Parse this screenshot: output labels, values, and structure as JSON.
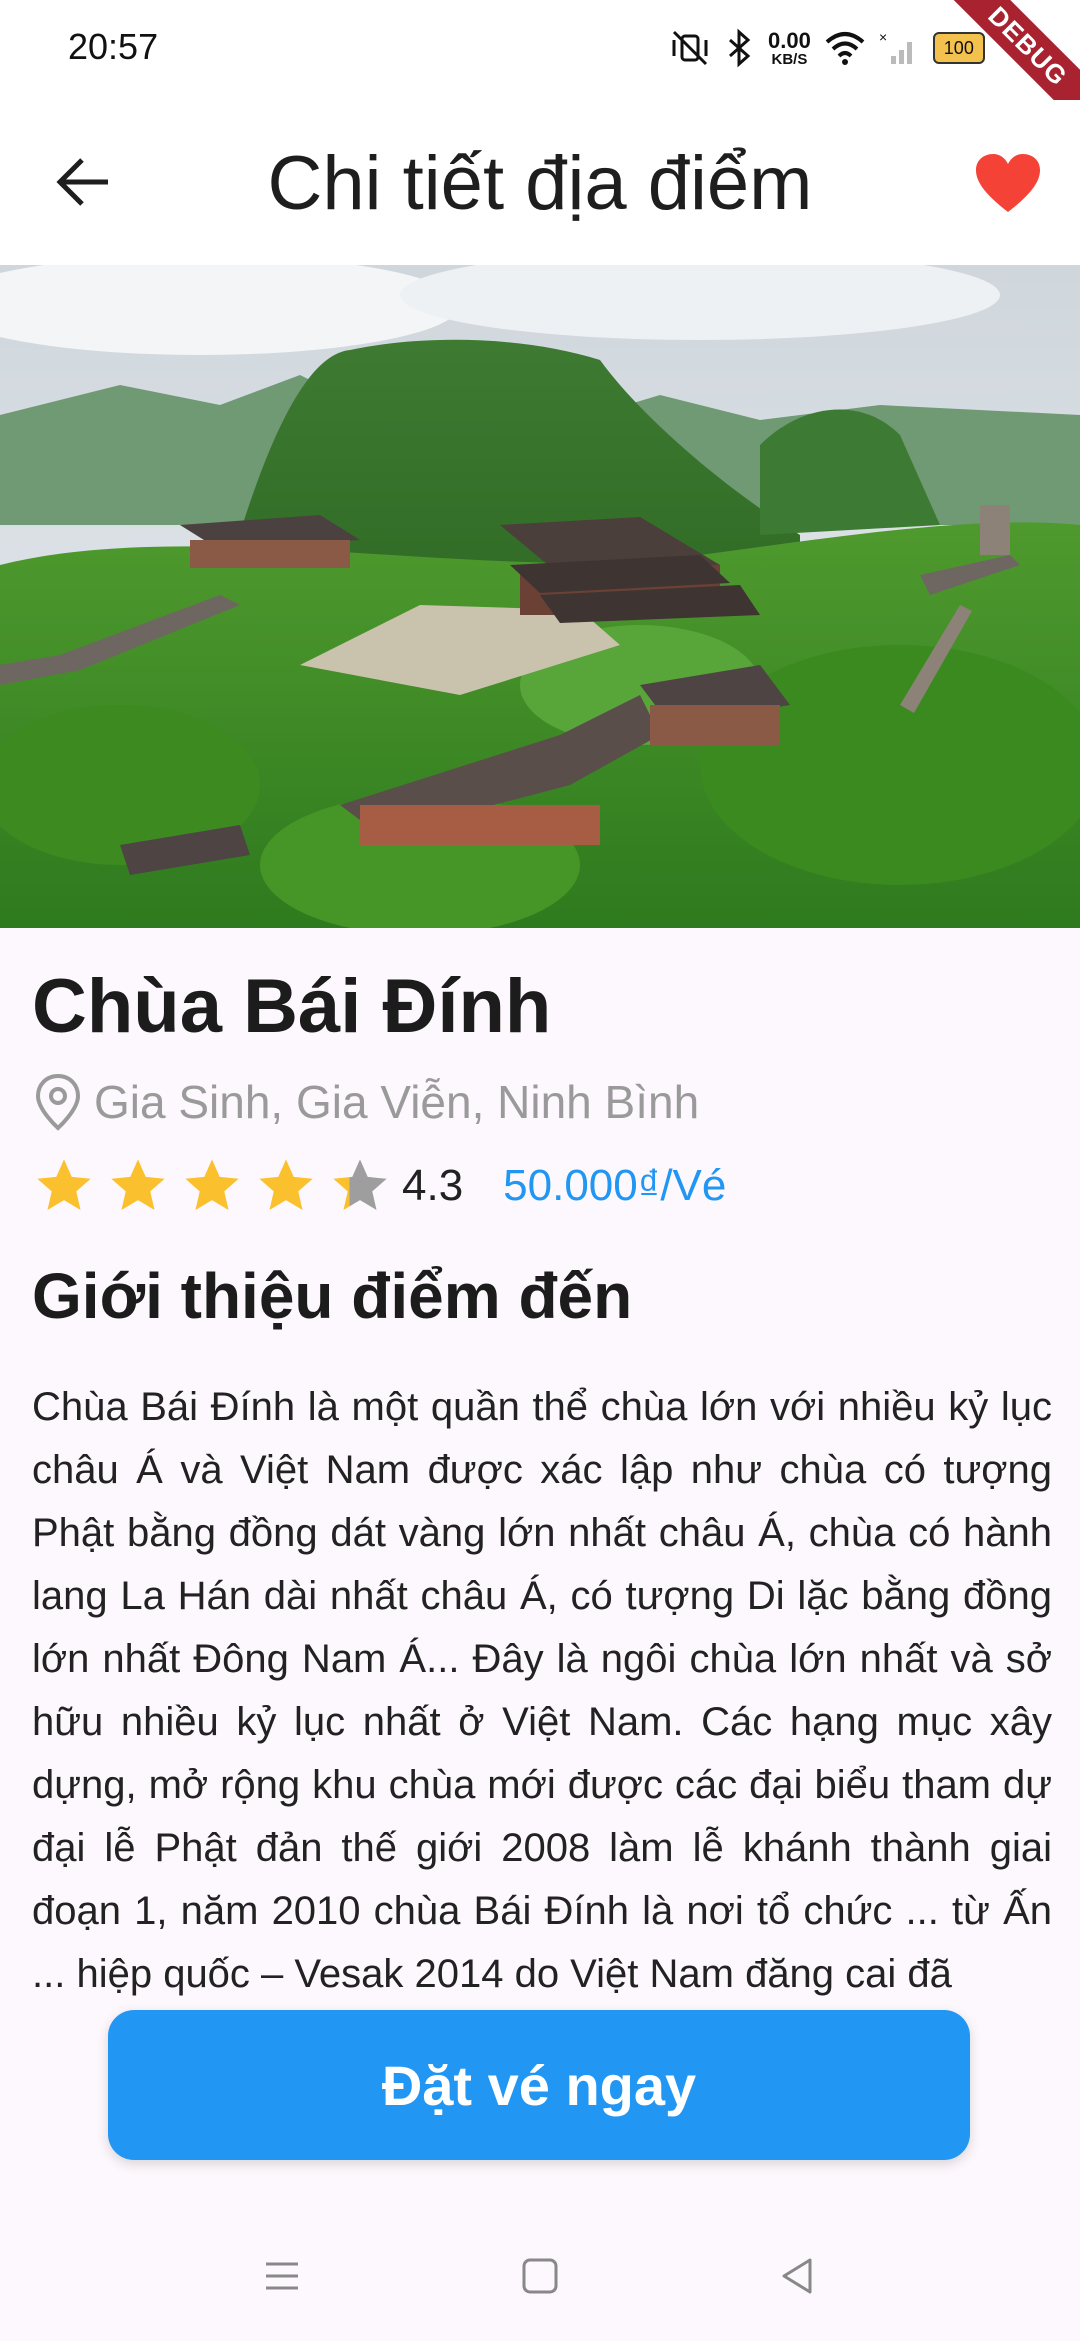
{
  "status_bar": {
    "time": "20:57",
    "net_speed_value": "0.00",
    "net_speed_unit": "KB/S",
    "battery": "100",
    "debug_banner": "DEBUG"
  },
  "app_bar": {
    "title": "Chi tiết địa điểm",
    "back_icon": "arrow-left-icon",
    "favorite_icon": "heart-icon",
    "favorite_color": "#f44336"
  },
  "place": {
    "name": "Chùa Bái Đính",
    "location": "Gia Sinh, Gia Viễn, Ninh Bình",
    "rating_value": 4.3,
    "rating": "4.3",
    "price": "50.000₫/Vé"
  },
  "intro": {
    "title": "Giới thiệu điểm đến",
    "text": "Chùa Bái Đính là một quần thể chùa lớn với nhiều kỷ lục châu Á và Việt Nam được xác lập như chùa có tượng Phật bằng đồng dát vàng lớn nhất châu Á, chùa có hành lang La Hán dài nhất châu Á, có tượng Di lặc bằng đồng lớn nhất Đông Nam Á... Đây là ngôi chùa lớn nhất và sở hữu nhiều kỷ lục nhất ở Việt Nam. Các hạng mục xây dựng, mở rộng khu chùa mới được các đại biểu tham dự đại lễ Phật đản thế giới 2008 làm lễ khánh thành giai đoạn 1, năm 2010 chùa Bái Đính là nơi tổ chức ... từ Ấn ... hiệp quốc – Vesak 2014 do Việt Nam đăng cai đã"
  },
  "cta": {
    "label": "Đặt vé ngay"
  },
  "colors": {
    "accent": "#2196f3",
    "star": "#fbc02d",
    "star_empty": "#9e9e9e"
  }
}
